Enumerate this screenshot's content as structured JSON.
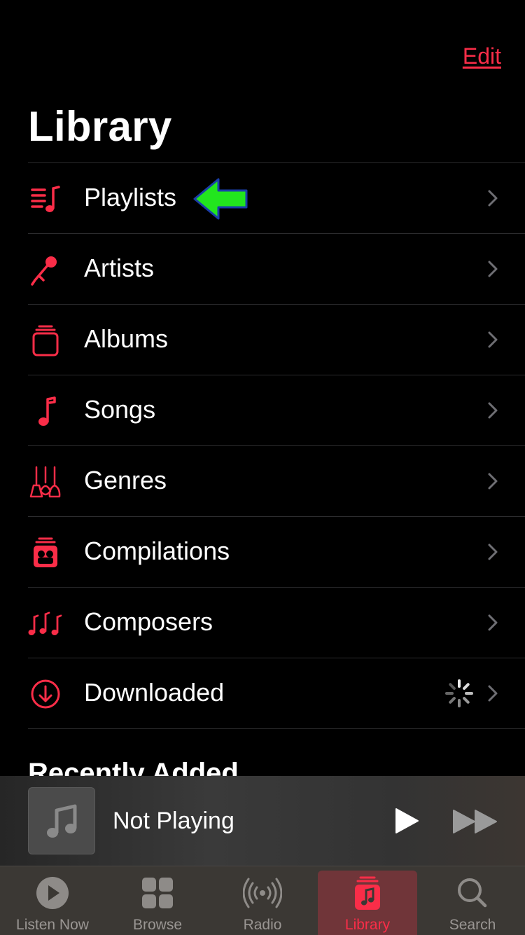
{
  "header": {
    "edit_label": "Edit",
    "title": "Library"
  },
  "library_items": [
    {
      "label": "Playlists",
      "icon": "playlists-icon"
    },
    {
      "label": "Artists",
      "icon": "microphone-icon"
    },
    {
      "label": "Albums",
      "icon": "album-stack-icon"
    },
    {
      "label": "Songs",
      "icon": "music-note-icon"
    },
    {
      "label": "Genres",
      "icon": "guitars-icon"
    },
    {
      "label": "Compilations",
      "icon": "compilation-icon"
    },
    {
      "label": "Composers",
      "icon": "music-notes-icon"
    },
    {
      "label": "Downloaded",
      "icon": "download-circle-icon"
    }
  ],
  "recently_added": {
    "heading": "Recently Added"
  },
  "mini_player": {
    "title": "Not Playing"
  },
  "tabs": [
    {
      "label": "Listen Now",
      "icon": "play-circle-icon"
    },
    {
      "label": "Browse",
      "icon": "grid-icon"
    },
    {
      "label": "Radio",
      "icon": "radio-waves-icon"
    },
    {
      "label": "Library",
      "icon": "library-icon",
      "active": true
    },
    {
      "label": "Search",
      "icon": "magnifier-icon"
    }
  ],
  "colors": {
    "accent": "#fa2d48",
    "background": "#000000",
    "pointer": "#22e61e"
  }
}
